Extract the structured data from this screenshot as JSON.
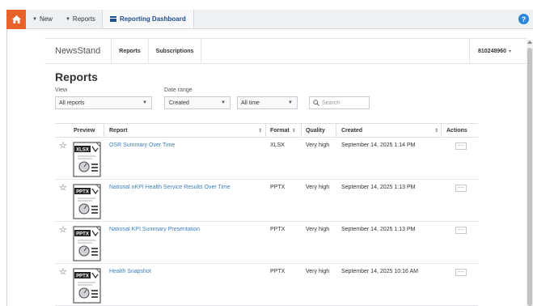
{
  "topbar": {
    "new_label": "New",
    "reports_label": "Reports",
    "dashboard_label": "Reporting Dashboard",
    "help_label": "?"
  },
  "subnav": {
    "brand": "NewsStand",
    "tabs": [
      "Reports",
      "Subscriptions"
    ],
    "account": "810248960"
  },
  "page": {
    "title": "Reports"
  },
  "filters": {
    "view_label": "View",
    "view_value": "All reports",
    "date_label": "Date range",
    "date_type_value": "Created",
    "date_range_value": "All time",
    "search_placeholder": "Search"
  },
  "table": {
    "headers": {
      "preview": "Preview",
      "report": "Report",
      "format": "Format",
      "quality": "Quality",
      "created": "Created",
      "actions": "Actions"
    },
    "rows": [
      {
        "name": "OSR Summary Over Time",
        "format": "XLSX",
        "quality": "Very high",
        "created": "September 14, 2025 1:14 PM",
        "badge": "XLSX"
      },
      {
        "name": "National nKPI Health Service Results Over Time",
        "format": "PPTX",
        "quality": "Very high",
        "created": "September 14, 2025 1:13 PM",
        "badge": "PPTX"
      },
      {
        "name": "National KPI Summary Presentation",
        "format": "PPTX",
        "quality": "Very high",
        "created": "September 14, 2025 1:13 PM",
        "badge": "PPTX"
      },
      {
        "name": "Health Snapshot",
        "format": "PPTX",
        "quality": "Very high",
        "created": "September 14, 2025 10:16 AM",
        "badge": "PPTX"
      }
    ],
    "action_label": "…"
  },
  "colors": {
    "home_orange": "#e8632b",
    "link_blue": "#3a7fc1",
    "dashboard_blue": "#1f4e8c",
    "help_blue": "#2b86d8"
  }
}
